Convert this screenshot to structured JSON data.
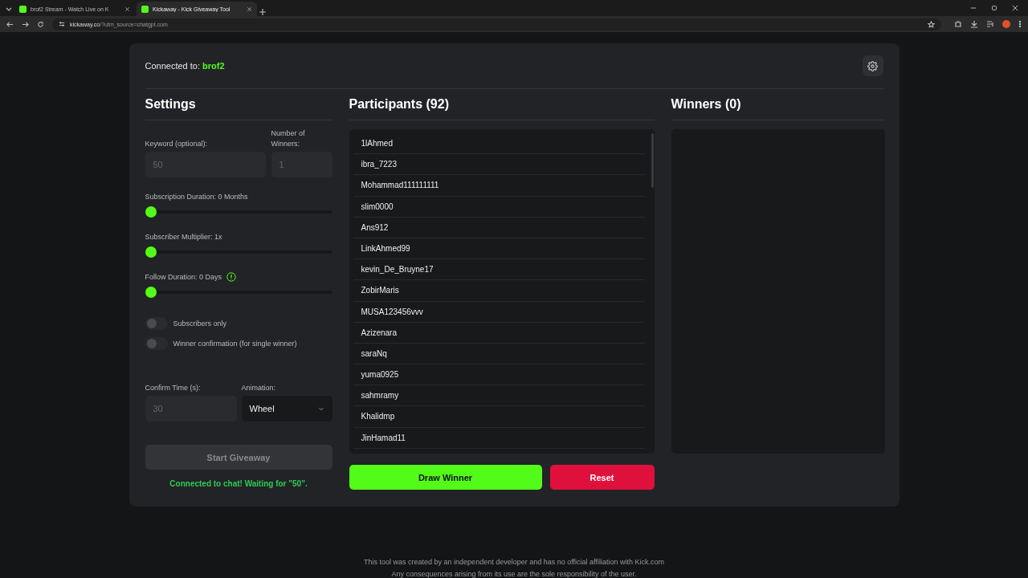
{
  "browser": {
    "tabs": [
      {
        "title": "brof2 Stream - Watch Live on K",
        "selected": false
      },
      {
        "title": "Kickaway - Kick Giveaway Tool",
        "selected": true
      }
    ],
    "address": {
      "domain": "kickaway.co",
      "path": "/?utm_source=chatgpt.com"
    }
  },
  "header": {
    "connected_label": "Connected to:",
    "channel": "brof2"
  },
  "settings": {
    "title": "Settings",
    "keyword": {
      "label": "Keyword (optional):",
      "value": "50",
      "disabled": true
    },
    "winner_count": {
      "label": "Number of Winners:",
      "value": "1",
      "disabled": true
    },
    "sliders": [
      {
        "label": "Subscription Duration: 0 Months",
        "level": 0,
        "info": false
      },
      {
        "label": "Subscriber Multiplier: 1x",
        "level": 0,
        "info": false
      },
      {
        "label": "Follow Duration: 0 Days",
        "level": 0,
        "info": true
      }
    ],
    "toggles": [
      {
        "label": "Subscribers only",
        "on": false
      },
      {
        "label": "Winner confirmation (for single winner)",
        "on": false
      }
    ],
    "confirm_time": {
      "label": "Confirm Time (s):",
      "value": "30",
      "disabled": true
    },
    "animation": {
      "label": "Animation:",
      "value": "Wheel"
    },
    "start_button": {
      "label": "Start Giveaway",
      "disabled": true
    },
    "status": "Connected to chat! Waiting for \"50\"."
  },
  "participants": {
    "title": "Participants (92)",
    "names": [
      "1lAhmed",
      "ibra_7223",
      "Mohammad111111111",
      "slim0000",
      "Ans912",
      "LinkAhmed99",
      "kevin_De_Bruyne17",
      "ZobirMaris",
      "MUSA123456vvv",
      "Azizenara",
      "saraNq",
      "yuma0925",
      "sahmramy",
      "Khalidmp",
      "JinHamad11"
    ]
  },
  "winners": {
    "title": "Winners (0)"
  },
  "draw_button": "Draw Winner",
  "reset_button": "Reset",
  "footer": [
    "This tool was created by an independent developer and has no official affiliation with Kick.com",
    "Any consequences arising from its use are the sole responsibility of the user."
  ]
}
